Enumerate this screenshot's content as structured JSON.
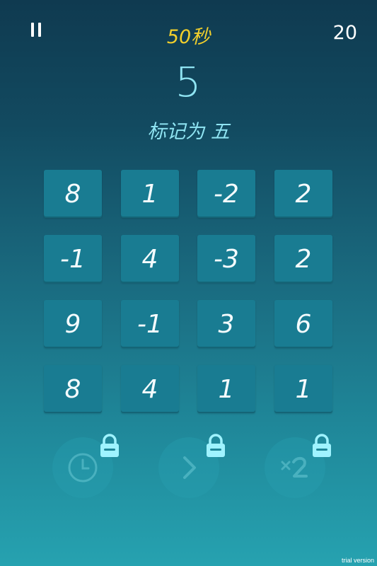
{
  "header": {
    "timer": "50秒",
    "score": "20",
    "timer_color": "#f1cf2c"
  },
  "target": {
    "number": "5",
    "instruction": "标记为 五"
  },
  "grid": {
    "rows": [
      [
        "8",
        "1",
        "-2",
        "2"
      ],
      [
        "-1",
        "4",
        "-3",
        "2"
      ],
      [
        "9",
        "-1",
        "3",
        "6"
      ],
      [
        "8",
        "4",
        "1",
        "1"
      ]
    ]
  },
  "powerups": [
    {
      "icon": "clock-icon",
      "locked": true
    },
    {
      "icon": "skip-arrow-icon",
      "locked": true
    },
    {
      "icon": "multiply-2-icon",
      "label": "x2",
      "locked": true
    }
  ],
  "footer": {
    "watermark": "trial version"
  },
  "colors": {
    "tile": "#197c92",
    "accent_text": "#8fe4f2",
    "lock_glow": "#9ff3ff"
  }
}
